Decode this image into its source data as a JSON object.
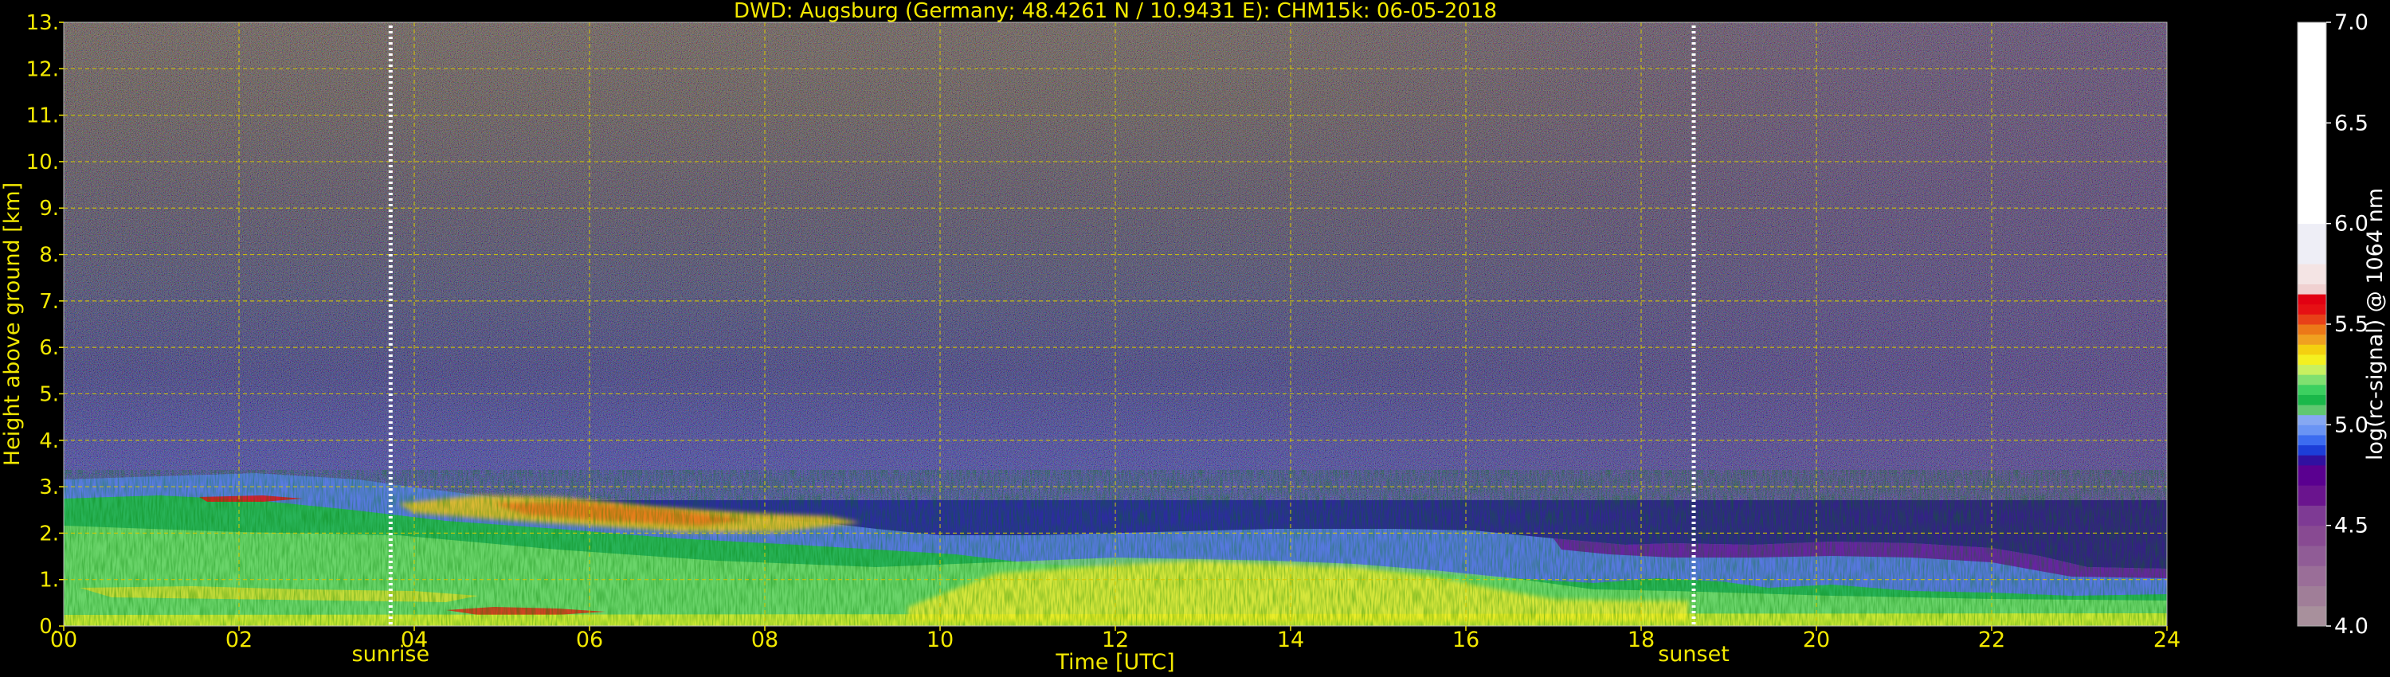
{
  "chart_data": {
    "type": "heatmap",
    "title": "DWD: Augsburg (Germany; 48.4261 N / 10.9431 E):    CHM15k: 06-05-2018",
    "xlabel": "Time [UTC]",
    "ylabel": "Height above ground [km]",
    "x_ticks": [
      "00",
      "02",
      "04",
      "06",
      "08",
      "10",
      "12",
      "14",
      "16",
      "18",
      "20",
      "22",
      "24"
    ],
    "x_tick_values": [
      0,
      2,
      4,
      6,
      8,
      10,
      12,
      14,
      16,
      18,
      20,
      22,
      24
    ],
    "y_ticks": [
      "0.",
      "1.",
      "2.",
      "3.",
      "4.",
      "5.",
      "6.",
      "7.",
      "8.",
      "9.",
      "10.",
      "11.",
      "12.",
      "13."
    ],
    "y_tick_values": [
      0,
      1,
      2,
      3,
      4,
      5,
      6,
      7,
      8,
      9,
      10,
      11,
      12,
      13
    ],
    "xlim": [
      0,
      24
    ],
    "ylim": [
      0,
      13
    ],
    "grid": true,
    "colorbar": {
      "label": "log(rc-signal) @ 1064 nm",
      "range": [
        4.0,
        7.0
      ],
      "ticks": [
        "4.0",
        "4.5",
        "5.0",
        "5.5",
        "6.0",
        "6.5",
        "7.0"
      ],
      "tick_values": [
        4.0,
        4.5,
        5.0,
        5.5,
        6.0,
        6.5,
        7.0
      ],
      "levels": [
        {
          "from": 4.0,
          "to": 4.1,
          "color": "#a8909c"
        },
        {
          "from": 4.1,
          "to": 4.2,
          "color": "#a07e98"
        },
        {
          "from": 4.2,
          "to": 4.3,
          "color": "#9a6e98"
        },
        {
          "from": 4.3,
          "to": 4.4,
          "color": "#905c96"
        },
        {
          "from": 4.4,
          "to": 4.5,
          "color": "#884a92"
        },
        {
          "from": 4.5,
          "to": 4.6,
          "color": "#7e3a94"
        },
        {
          "from": 4.6,
          "to": 4.7,
          "color": "#6a148e"
        },
        {
          "from": 4.7,
          "to": 4.8,
          "color": "#5a0090"
        },
        {
          "from": 4.8,
          "to": 4.85,
          "color": "#3010a0"
        },
        {
          "from": 4.85,
          "to": 4.9,
          "color": "#1c3ed8"
        },
        {
          "from": 4.9,
          "to": 4.95,
          "color": "#3c6cf0"
        },
        {
          "from": 4.95,
          "to": 5.0,
          "color": "#6a94f4"
        },
        {
          "from": 5.0,
          "to": 5.05,
          "color": "#86a8f2"
        },
        {
          "from": 5.05,
          "to": 5.1,
          "color": "#60c870"
        },
        {
          "from": 5.1,
          "to": 5.15,
          "color": "#1ab84a"
        },
        {
          "from": 5.15,
          "to": 5.2,
          "color": "#3cd060"
        },
        {
          "from": 5.2,
          "to": 5.25,
          "color": "#80e070"
        },
        {
          "from": 5.25,
          "to": 5.3,
          "color": "#c8f060"
        },
        {
          "from": 5.3,
          "to": 5.35,
          "color": "#f4f020"
        },
        {
          "from": 5.35,
          "to": 5.4,
          "color": "#f4d010"
        },
        {
          "from": 5.4,
          "to": 5.45,
          "color": "#f0a020"
        },
        {
          "from": 5.45,
          "to": 5.5,
          "color": "#ec7818"
        },
        {
          "from": 5.5,
          "to": 5.55,
          "color": "#e84018"
        },
        {
          "from": 5.55,
          "to": 5.6,
          "color": "#e61014"
        },
        {
          "from": 5.6,
          "to": 5.65,
          "color": "#e20012"
        },
        {
          "from": 5.65,
          "to": 5.7,
          "color": "#f0d0d0"
        },
        {
          "from": 5.7,
          "to": 5.8,
          "color": "#f4e4e4"
        },
        {
          "from": 5.8,
          "to": 6.0,
          "color": "#eeeef6"
        },
        {
          "from": 6.0,
          "to": 7.0,
          "color": "#ffffff"
        }
      ]
    },
    "markers": [
      {
        "label": "sunrise",
        "x": 3.73
      },
      {
        "label": "sunset",
        "x": 18.6
      }
    ]
  }
}
